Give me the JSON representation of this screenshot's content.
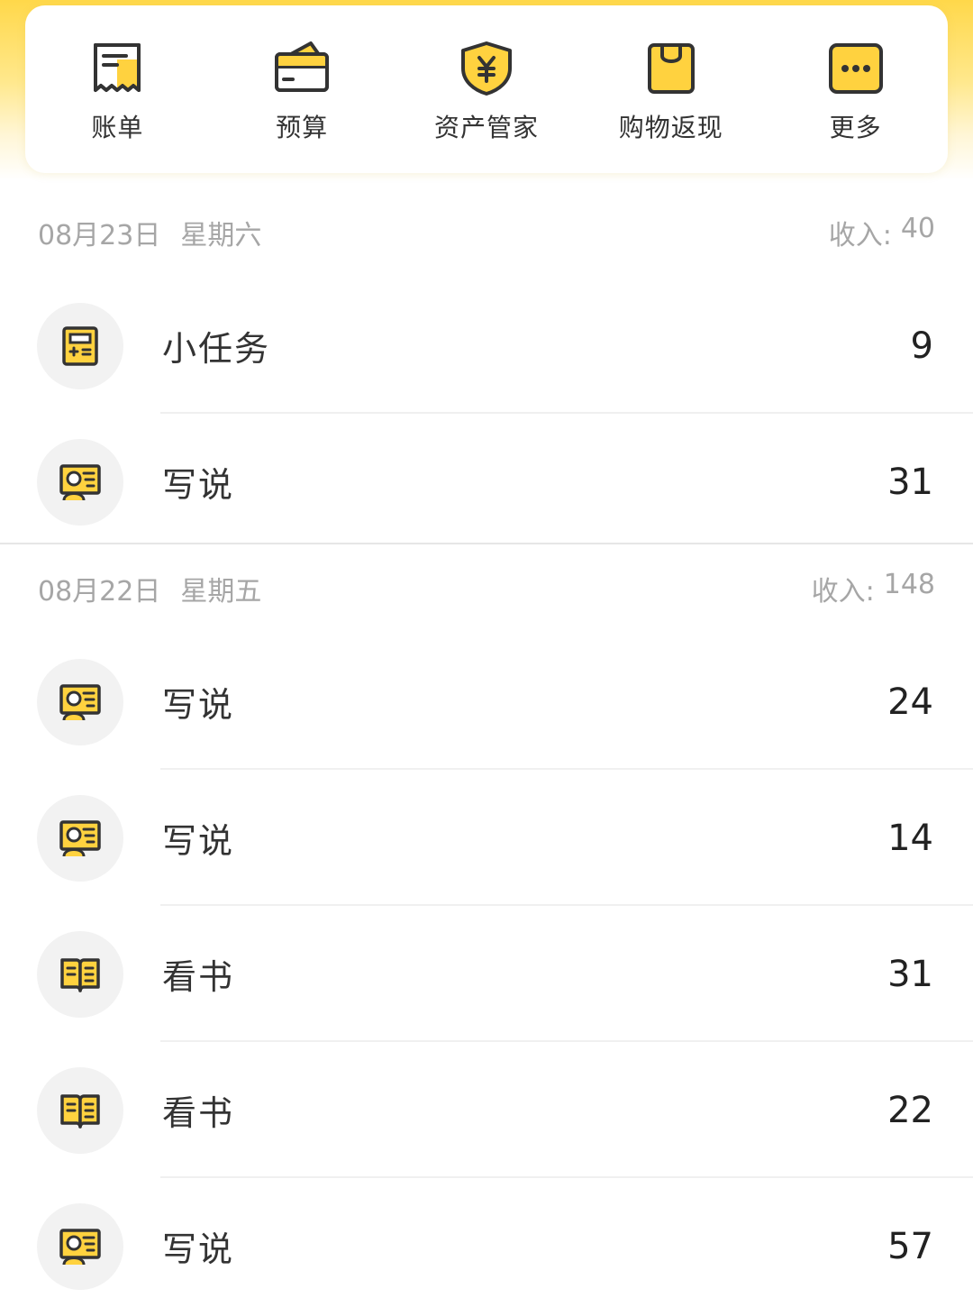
{
  "colors": {
    "accent": "#FFD84A",
    "icon_fill": "#FFD23F",
    "icon_stroke": "#333333"
  },
  "quick_menu": [
    {
      "label": "账单",
      "icon": "bill-icon"
    },
    {
      "label": "预算",
      "icon": "wallet-icon"
    },
    {
      "label": "资产管家",
      "icon": "shield-yen-icon"
    },
    {
      "label": "购物返现",
      "icon": "shopping-bag-icon"
    },
    {
      "label": "更多",
      "icon": "more-icon"
    }
  ],
  "sections": [
    {
      "date": "08月23日",
      "weekday": "星期六",
      "income_label": "收入:",
      "income_value": "40",
      "items": [
        {
          "title": "小任务",
          "value": "9",
          "icon": "calculator-icon"
        },
        {
          "title": "写说",
          "value": "31",
          "icon": "presentation-icon"
        }
      ]
    },
    {
      "date": "08月22日",
      "weekday": "星期五",
      "income_label": "收入:",
      "income_value": "148",
      "items": [
        {
          "title": "写说",
          "value": "24",
          "icon": "presentation-icon"
        },
        {
          "title": "写说",
          "value": "14",
          "icon": "presentation-icon"
        },
        {
          "title": "看书",
          "value": "31",
          "icon": "book-icon"
        },
        {
          "title": "看书",
          "value": "22",
          "icon": "book-icon"
        },
        {
          "title": "写说",
          "value": "57",
          "icon": "presentation-icon"
        }
      ]
    }
  ]
}
